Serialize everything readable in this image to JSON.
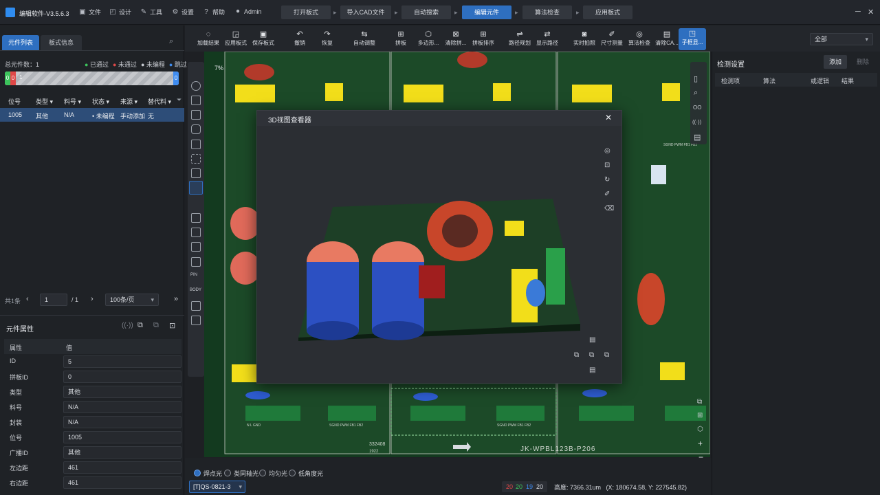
{
  "app": {
    "title": "编辑软件-V3.5.6.3"
  },
  "menu": [
    {
      "label": "文件",
      "icon": "folder-icon"
    },
    {
      "label": "设计",
      "icon": "design-icon"
    },
    {
      "label": "工具",
      "icon": "wrench-icon"
    },
    {
      "label": "设置",
      "icon": "gear-icon"
    },
    {
      "label": "帮助",
      "icon": "help-icon"
    },
    {
      "label": "Admin",
      "icon": "user-icon"
    }
  ],
  "workflow": [
    "打开板式",
    "导入CAD文件",
    "自动搜索",
    "编辑元件",
    "算法检查",
    "应用板式"
  ],
  "left": {
    "tabs": [
      "元件列表",
      "板式信息"
    ],
    "total_label": "总元件数：1",
    "legend": [
      {
        "label": "已通过",
        "color": "#3cc45c"
      },
      {
        "label": "未通过",
        "color": "#e04848"
      },
      {
        "label": "未编程",
        "color": "#c8ccd2"
      },
      {
        "label": "跳过",
        "color": "#3f8cf0"
      }
    ],
    "progress": {
      "left_a": "0",
      "left_b": "0",
      "mid": "1",
      "right": "0"
    },
    "columns": [
      "位号",
      "类型",
      "料号",
      "状态",
      "来源",
      "替代料"
    ],
    "row": {
      "ref": "1005",
      "type": "其他",
      "part": "N/A",
      "status": "未编程",
      "source": "手动添加",
      "alt": "无"
    },
    "pager": {
      "total": "共1条",
      "page": "1",
      "pages": "/ 1",
      "per_page": "100条/页"
    },
    "props_title": "元件属性",
    "props_header": {
      "k": "属性",
      "v": "值"
    },
    "props": [
      {
        "k": "ID",
        "v": "5"
      },
      {
        "k": "拼板ID",
        "v": "0"
      },
      {
        "k": "类型",
        "v": "其他"
      },
      {
        "k": "料号",
        "v": "N/A"
      },
      {
        "k": "封装",
        "v": "N/A"
      },
      {
        "k": "位号",
        "v": "1005"
      },
      {
        "k": "广播ID",
        "v": "其他"
      },
      {
        "k": "左边距",
        "v": "461"
      },
      {
        "k": "右边距",
        "v": "461"
      }
    ]
  },
  "toolbar": [
    "加载结果",
    "应用板式",
    "保存板式",
    "撤销",
    "恢复",
    "自动调整",
    "拼板",
    "多边形...",
    "清除拼...",
    "拼板排序",
    "路径规划",
    "显示路径",
    "实时拍照",
    "尺寸测量",
    "算法检查",
    "清除CA...",
    "子框显..."
  ],
  "canvas": {
    "zoom": "7%",
    "board_text_1": "JK-WPBL123B-P206",
    "board_text_2": "332408",
    "board_text_3": "1922",
    "gnd_labels": [
      "SGND PWM FB1 FB2",
      "SGND PWM FB1 FB2",
      "SGND PWM FB1 FB2"
    ],
    "lgnd": "N   L   GND"
  },
  "dialog": {
    "title": "3D视图查看器",
    "close": "✕"
  },
  "right": {
    "select": "全部",
    "title": "检测设置",
    "add": "添加",
    "delete": "删除",
    "columns": [
      "检测项",
      "算法",
      "或逻辑",
      "结果"
    ]
  },
  "bottom": {
    "lights": [
      "焊点光",
      "类同轴光",
      "均匀光",
      "低角度光"
    ],
    "board_id": "[T]QS-0821-3",
    "counts": [
      {
        "v": "20",
        "color": "#e04848"
      },
      {
        "v": "20",
        "color": "#3cc45c"
      },
      {
        "v": "19",
        "color": "#3f8cf0"
      },
      {
        "v": "20",
        "color": "#d8dbe0"
      }
    ],
    "status": "高度: 7366.31um   (X: 180674.58, Y: 227545.82)"
  }
}
